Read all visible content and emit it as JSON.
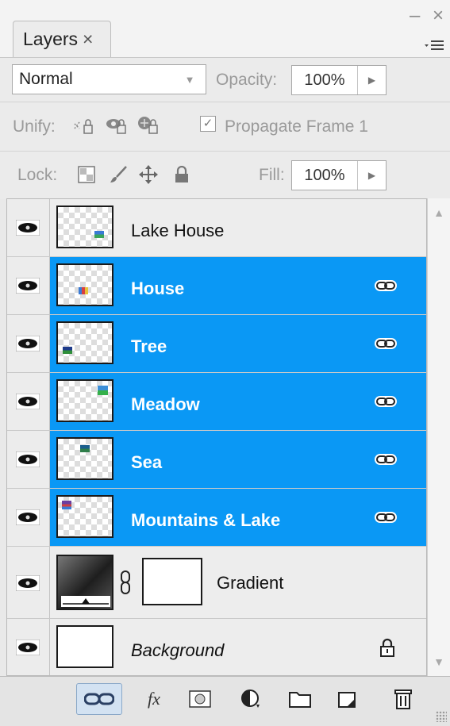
{
  "panel": {
    "tab_label": "Layers",
    "tab_close": "×",
    "minimize": "–",
    "close": "×"
  },
  "options": {
    "blend_mode": "Normal",
    "opacity_label": "Opacity:",
    "opacity_value": "100%",
    "unify_label": "Unify:",
    "propagate_label": "Propagate Frame 1",
    "propagate_checked": true,
    "lock_label": "Lock:",
    "fill_label": "Fill:",
    "fill_value": "100%"
  },
  "layers": [
    {
      "name": "Lake House",
      "selected": false,
      "visible": true,
      "linked": false
    },
    {
      "name": "House",
      "selected": true,
      "visible": true,
      "linked": true
    },
    {
      "name": "Tree",
      "selected": true,
      "visible": true,
      "linked": true
    },
    {
      "name": "Meadow",
      "selected": true,
      "visible": true,
      "linked": true
    },
    {
      "name": "Sea",
      "selected": true,
      "visible": true,
      "linked": true
    },
    {
      "name": "Mountains & Lake",
      "selected": true,
      "visible": true,
      "linked": true
    },
    {
      "name": "Gradient",
      "selected": false,
      "visible": true,
      "linked": false
    },
    {
      "name": "Background",
      "selected": false,
      "visible": true,
      "linked": false,
      "locked": true
    }
  ],
  "colors": {
    "selection": "#0a98f5",
    "panel_bg": "#e9e9e9"
  }
}
